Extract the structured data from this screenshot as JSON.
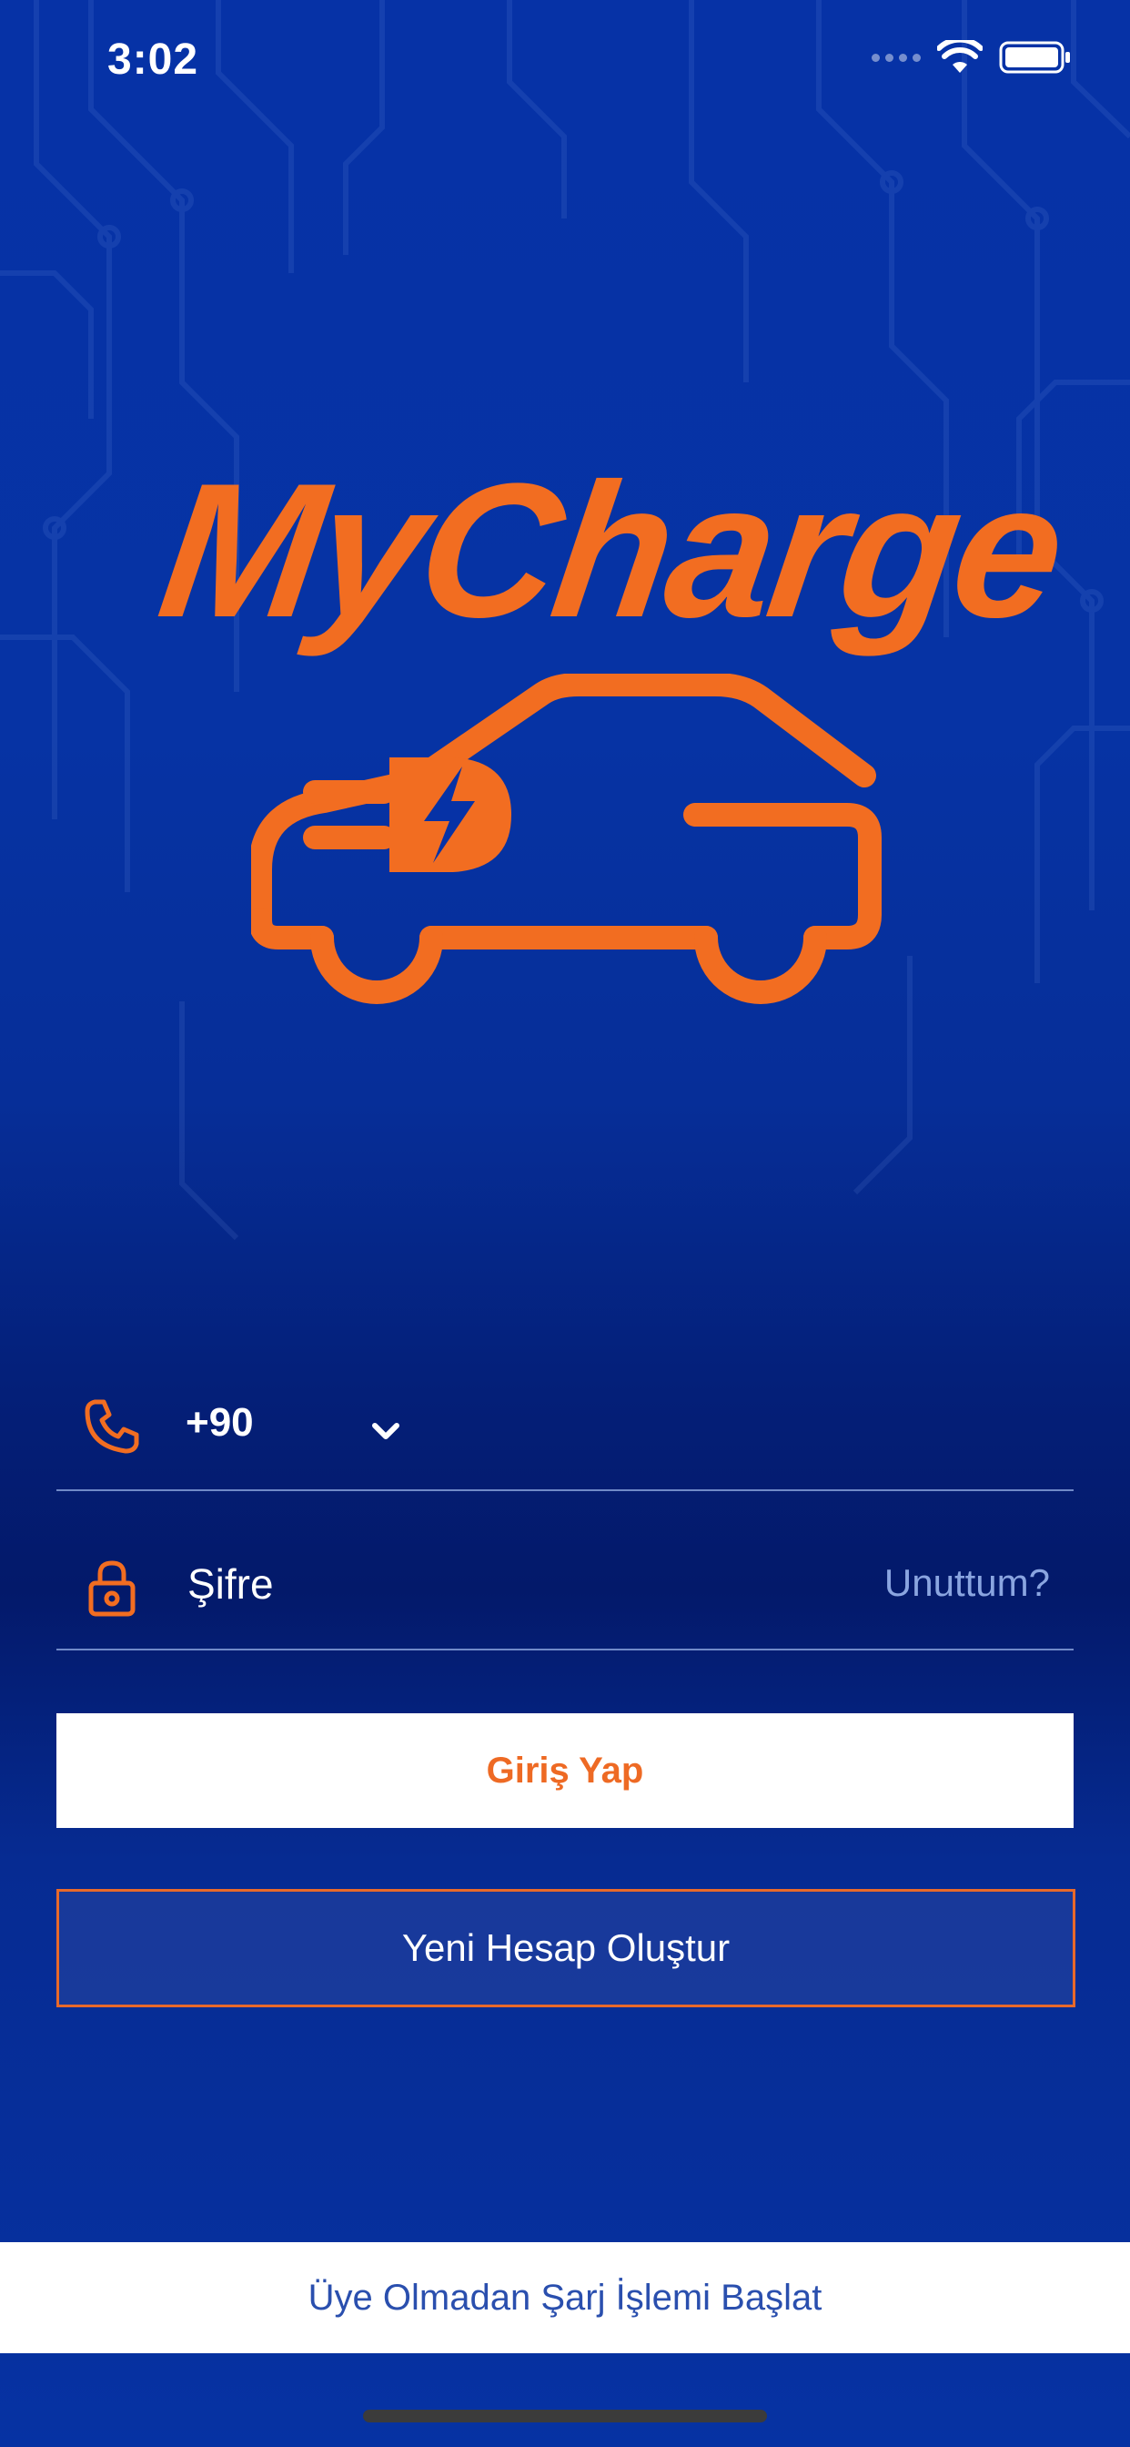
{
  "status_bar": {
    "time": "3:02",
    "icons": [
      "cellular-dots-icon",
      "wifi-icon",
      "battery-icon"
    ]
  },
  "brand": {
    "name": "MyCharge",
    "logo_icon": "electric-car-plug-icon",
    "accent_color": "#f26d21",
    "background_color": "#0632a6"
  },
  "login_form": {
    "phone": {
      "icon": "phone-icon",
      "country_code": "+90",
      "dropdown_icon": "chevron-down-icon"
    },
    "password": {
      "icon": "lock-icon",
      "placeholder": "Şifre",
      "forgot_label": "Unuttum?"
    },
    "login_button": "Giriş Yap",
    "register_button": "Yeni Hesap Oluştur"
  },
  "guest_action": {
    "label": "Üye Olmadan Şarj İşlemi Başlat"
  }
}
